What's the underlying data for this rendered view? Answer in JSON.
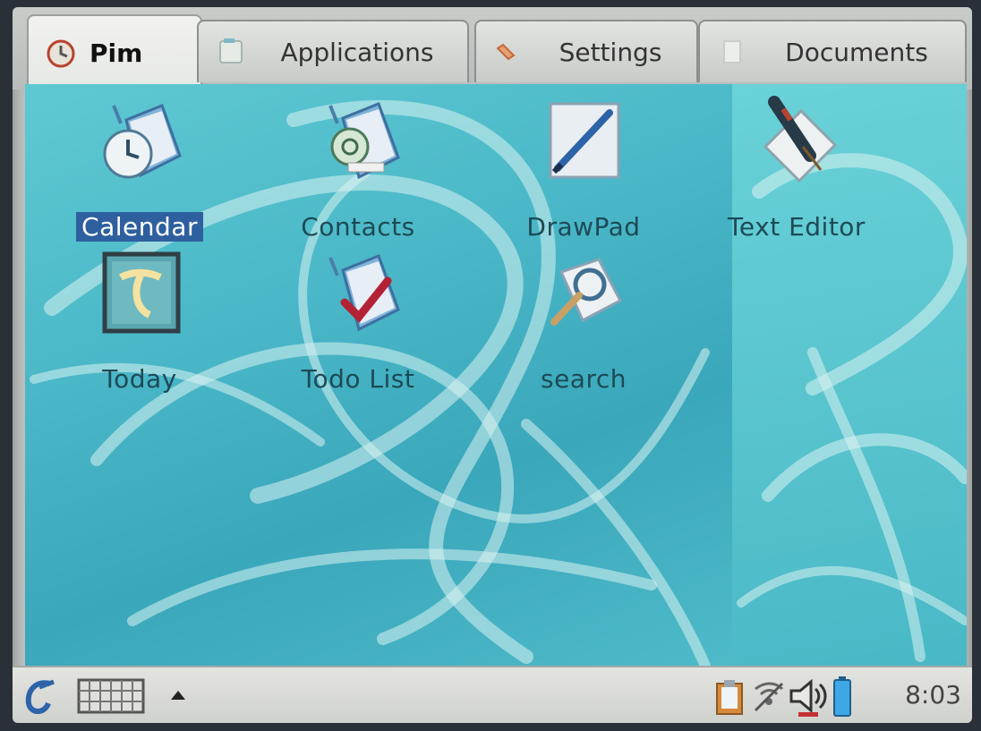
{
  "tabs": [
    {
      "label": "Pim",
      "icon": "pim-icon",
      "active": true
    },
    {
      "label": "Applications",
      "icon": "applications-icon",
      "active": false
    },
    {
      "label": "Settings",
      "icon": "settings-icon",
      "active": false
    },
    {
      "label": "Documents",
      "icon": "documents-icon",
      "active": false
    }
  ],
  "apps": [
    {
      "label": "Calendar",
      "icon": "calendar-icon",
      "selected": true
    },
    {
      "label": "Contacts",
      "icon": "contacts-icon",
      "selected": false
    },
    {
      "label": "DrawPad",
      "icon": "drawpad-icon",
      "selected": false
    },
    {
      "label": "Text Editor",
      "icon": "text-editor-icon",
      "selected": false
    },
    {
      "label": "Today",
      "icon": "today-icon",
      "selected": false
    },
    {
      "label": "Todo List",
      "icon": "todo-list-icon",
      "selected": false
    },
    {
      "label": "search",
      "icon": "search-icon",
      "selected": false
    }
  ],
  "taskbar": {
    "start_icon": "opie-logo-icon",
    "keyboard_icon": "keyboard-icon",
    "arrow_icon": "up-arrow-icon",
    "tray_icons": [
      "clipboard-icon",
      "network-icon",
      "volume-icon",
      "battery-icon"
    ],
    "clock": "8:03"
  },
  "colors": {
    "desktop": "#49b7c7",
    "selection": "#2e5f9e",
    "label_text": "#1d4a55"
  }
}
